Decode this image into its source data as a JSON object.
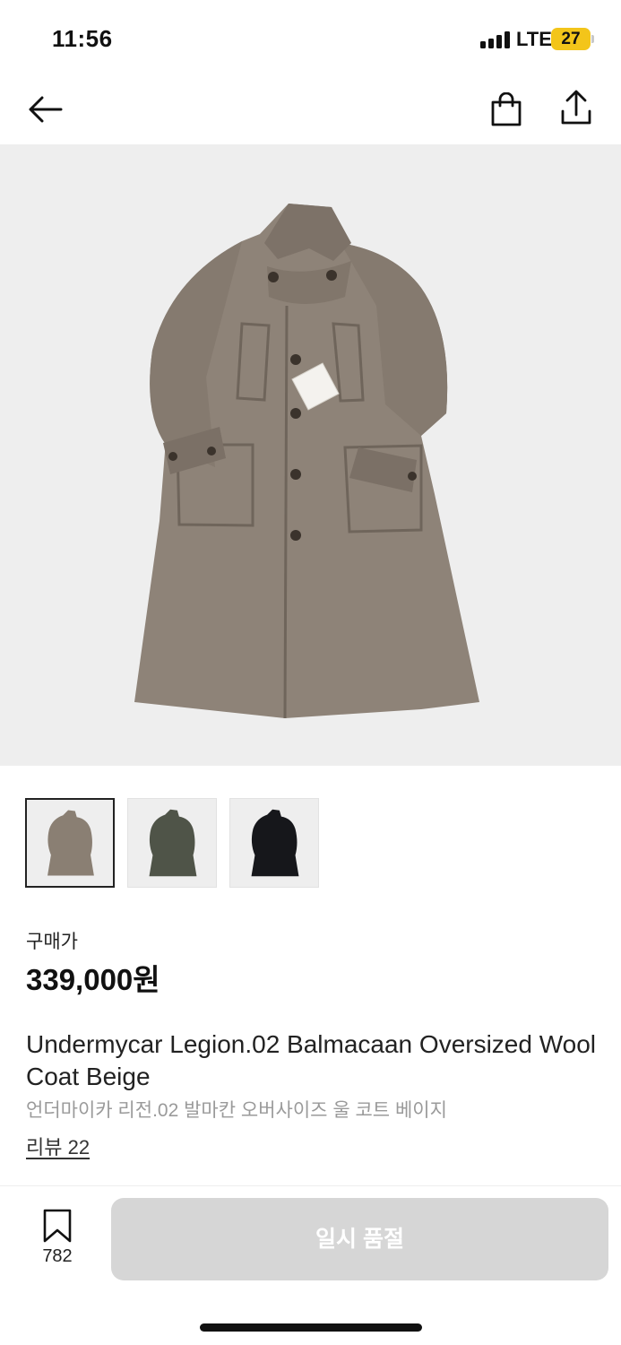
{
  "status_bar": {
    "time": "11:56",
    "network": "LTE",
    "battery_level": "27",
    "battery_color": "#f3c51a"
  },
  "nav": {
    "back_icon": "arrow-left-icon",
    "cart_icon": "shopping-bag-icon",
    "share_icon": "share-icon"
  },
  "gallery": {
    "thumbnails": [
      {
        "color_name": "beige",
        "swatch": "#8a7f73",
        "selected": true
      },
      {
        "color_name": "olive",
        "swatch": "#4f5448",
        "selected": false
      },
      {
        "color_name": "black",
        "swatch": "#16171b",
        "selected": false
      }
    ]
  },
  "product": {
    "price_label": "구매가",
    "price": "339,000원",
    "title_en": "Undermycar Legion.02 Balmacaan Oversized Wool Coat Beige",
    "title_ko": "언더마이카 리전.02 발마칸 오버사이즈 울 코트 베이지",
    "review_link": "리뷰 22"
  },
  "bottom_bar": {
    "bookmark_icon": "bookmark-icon",
    "bookmark_count": "782",
    "buy_button_label": "일시 품절",
    "buy_button_color": "#d6d6d6"
  }
}
